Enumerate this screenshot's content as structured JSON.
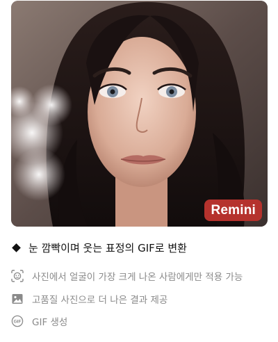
{
  "photo": {
    "description_icon": "portrait-photo",
    "badge_label": "Remini",
    "badge_color": "#b5322d"
  },
  "headline": {
    "text": "눈 깜빡이며 웃는 표정의 GIF로 변환",
    "bullet_icon": "diamond-icon"
  },
  "features": [
    {
      "icon": "face-scan-icon",
      "label": "사진에서 얼굴이 가장 크게 나온 사람에게만 적용 가능"
    },
    {
      "icon": "image-icon",
      "label": "고품질 사진으로 더 나은 결과 제공"
    },
    {
      "icon": "gif-icon",
      "label": "GIF 생성"
    }
  ],
  "colors": {
    "headline_text": "#111111",
    "feature_text": "#8a8a8a"
  }
}
